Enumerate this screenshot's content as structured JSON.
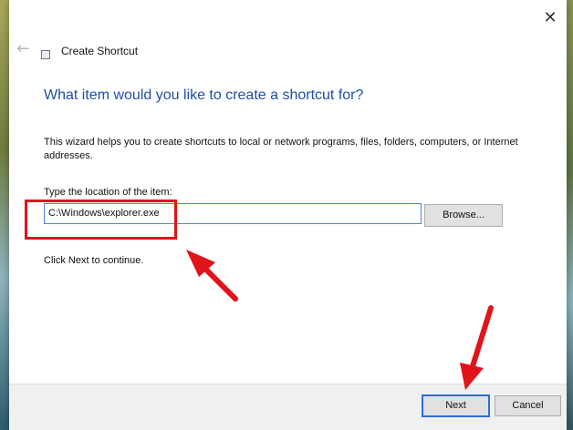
{
  "window": {
    "title": "Create Shortcut",
    "close_icon": "close-icon",
    "back_icon": "back-arrow-icon"
  },
  "wizard": {
    "heading": "What item would you like to create a shortcut for?",
    "description": "This wizard helps you to create shortcuts to local or network programs, files, folders, computers, or Internet addresses.",
    "location_label": "Type the location of the item:",
    "location_value": "C:\\Windows\\explorer.exe",
    "browse_label": "Browse...",
    "continue_text": "Click Next to continue."
  },
  "footer": {
    "next_label": "Next",
    "cancel_label": "Cancel"
  },
  "colors": {
    "heading": "#1f4fa3",
    "accent": "#2b6fd6",
    "annotation": "#e0141b"
  }
}
